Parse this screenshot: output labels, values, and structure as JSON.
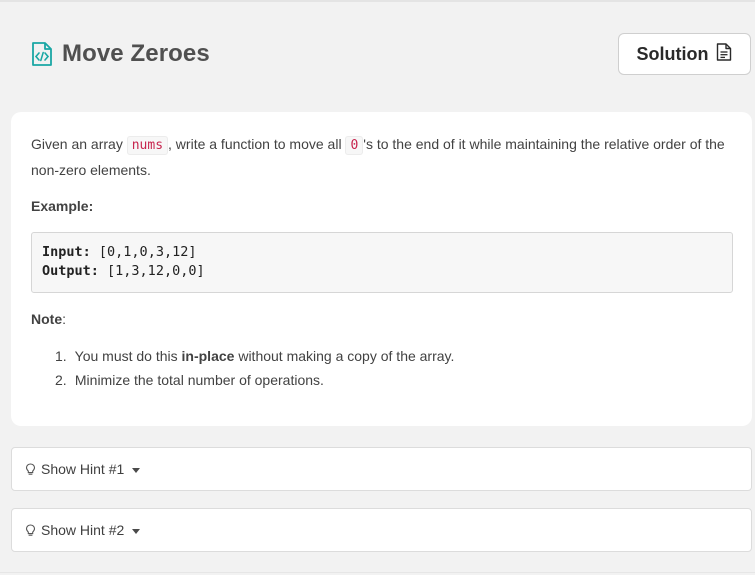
{
  "problem": {
    "title": "Move Zeroes",
    "title_icon": "code-file-icon",
    "accent_color": "#1aa7a4"
  },
  "solution_button": {
    "label": "Solution",
    "icon": "document-icon"
  },
  "description": {
    "intro_before_nums": "Given an array ",
    "nums_code": "nums",
    "intro_after_nums": ", write a function to move all ",
    "zero_code": "0",
    "intro_after_zero": "'s to the end of it while maintaining the relative order of the non-zero elements.",
    "example_label": "Example:",
    "example": {
      "input_label": "Input:",
      "input_value": "[0,1,0,3,12]",
      "output_label": "Output:",
      "output_value": "[1,3,12,0,0]"
    },
    "note_label": "Note",
    "note_colon": ":",
    "notes": [
      {
        "num": "1.",
        "before": "You must do this ",
        "bold": "in-place",
        "after": " without making a copy of the array."
      },
      {
        "num": "2.",
        "before": "Minimize the total number of operations.",
        "bold": "",
        "after": ""
      }
    ]
  },
  "hints": [
    {
      "label": "Show Hint #1",
      "icon": "lightbulb-icon"
    },
    {
      "label": "Show Hint #2",
      "icon": "lightbulb-icon"
    }
  ]
}
